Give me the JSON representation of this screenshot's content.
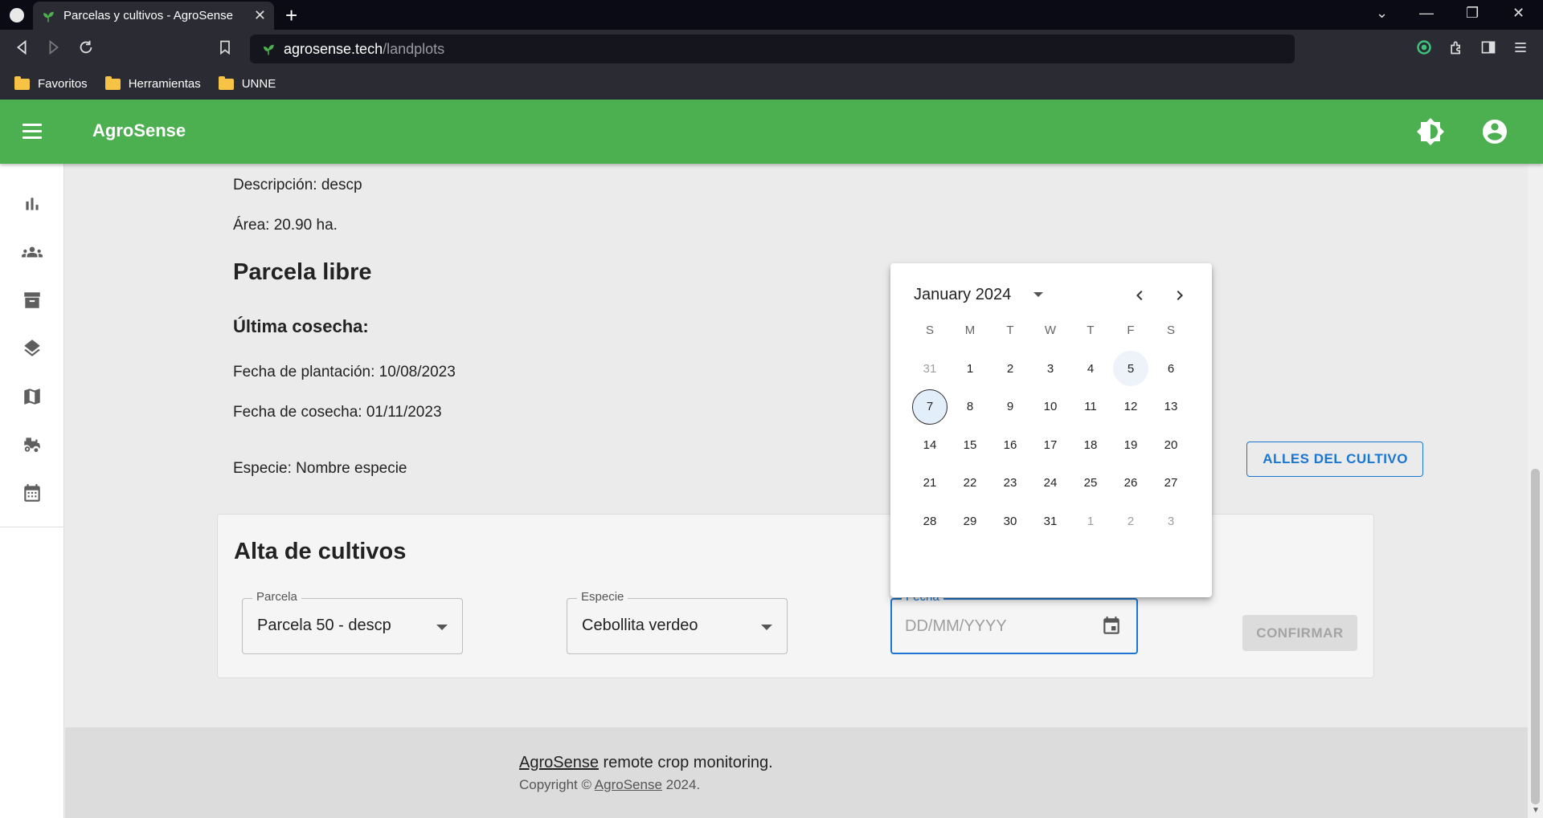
{
  "browser": {
    "tab_title": "Parcelas y cultivos - AgroSense",
    "tab_close": "✕",
    "new_tab": "+",
    "url_domain": "agrosense.tech",
    "url_path": "/landplots",
    "bookmarks": [
      "Favoritos",
      "Herramientas",
      "UNNE"
    ],
    "window_controls": [
      "⌄",
      "—",
      "❐",
      "✕"
    ]
  },
  "app": {
    "brand": "AgroSense",
    "accent_color": "#4caf50",
    "sidebar_icons": [
      "bar-chart-icon",
      "groups-icon",
      "archive-icon",
      "layers-icon",
      "map-icon",
      "tractor-icon",
      "calendar-icon"
    ]
  },
  "plot": {
    "description": "Descripción: descp",
    "area": "Área: 20.90 ha.",
    "status_title": "Parcela libre",
    "last_harvest_title": "Última cosecha:",
    "planting_date": "Fecha de plantación: 10/08/2023",
    "harvest_date": "Fecha de cosecha: 01/11/2023",
    "species": "Especie: Nombre especie",
    "details_button": "ALLES DEL CULTIVO"
  },
  "form": {
    "title": "Alta de cultivos",
    "parcela_label": "Parcela",
    "parcela_value": "Parcela 50 - descp",
    "especie_label": "Especie",
    "especie_value": "Cebollita verdeo",
    "fecha_label": "Fecha",
    "fecha_placeholder": "DD/MM/YYYY",
    "confirm_button": "CONFIRMAR"
  },
  "datepicker": {
    "month_label": "January 2024",
    "weekdays": [
      "S",
      "M",
      "T",
      "W",
      "T",
      "F",
      "S"
    ],
    "weeks": [
      [
        "31",
        "1",
        "2",
        "3",
        "4",
        "5",
        "6"
      ],
      [
        "7",
        "8",
        "9",
        "10",
        "11",
        "12",
        "13"
      ],
      [
        "14",
        "15",
        "16",
        "17",
        "18",
        "19",
        "20"
      ],
      [
        "21",
        "22",
        "23",
        "24",
        "25",
        "26",
        "27"
      ],
      [
        "28",
        "29",
        "30",
        "31",
        "1",
        "2",
        "3"
      ]
    ],
    "selected_day": "7",
    "today_day": "5"
  },
  "footer": {
    "brand_link": "AgroSense",
    "tagline": " remote crop monitoring.",
    "copyright_prefix": "Copyright © ",
    "copyright_link": "AgroSense",
    "copyright_suffix": " 2024."
  }
}
